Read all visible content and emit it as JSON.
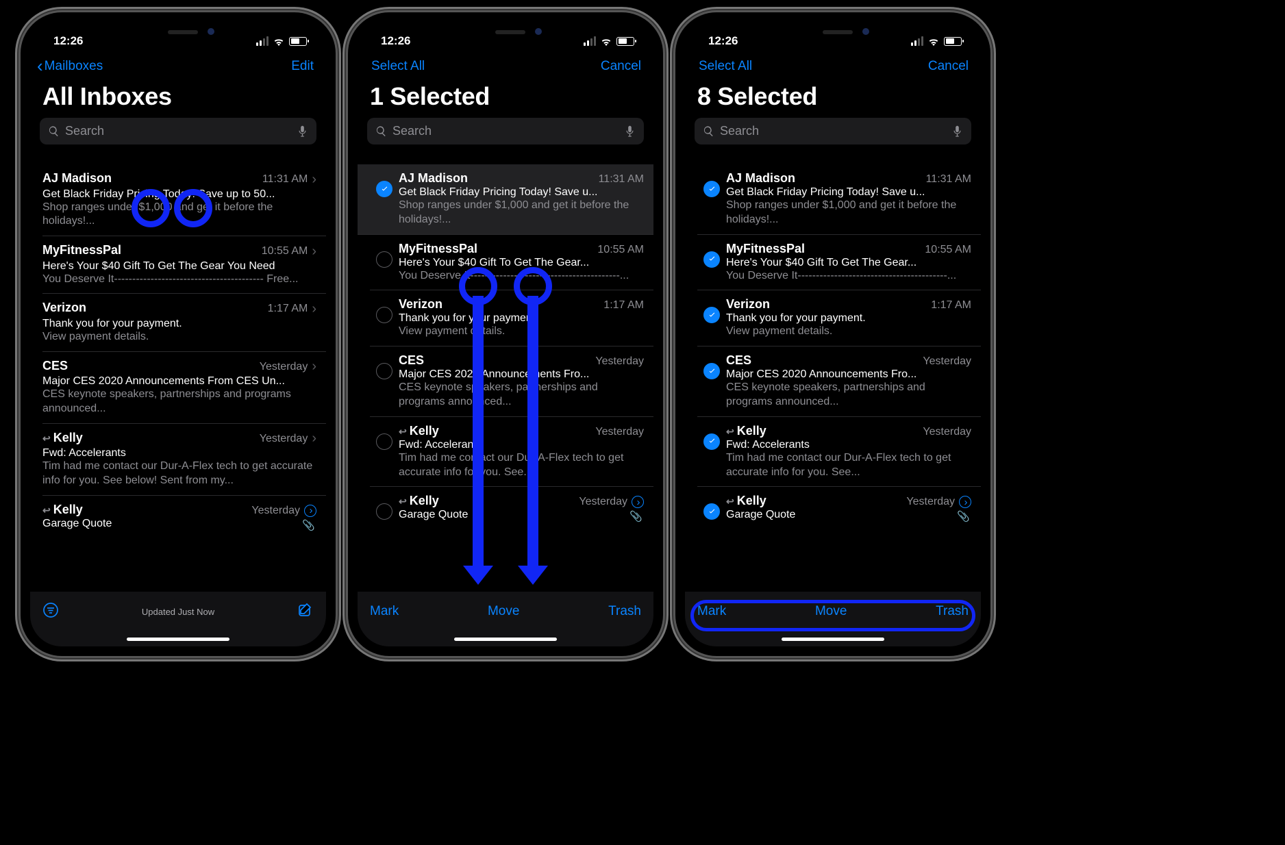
{
  "status": {
    "time": "12:26"
  },
  "search": {
    "placeholder": "Search"
  },
  "screens": [
    {
      "nav": {
        "left": "Mailboxes",
        "right": "Edit",
        "hasChevron": true
      },
      "title": "All Inboxes",
      "mode": "normal",
      "footer": {
        "type": "status",
        "center": "Updated Just Now"
      },
      "messages": [
        {
          "sender": "AJ Madison",
          "time": "11:31 AM",
          "subject": "Get Black Friday Pricing Today! Save up to 50...",
          "preview": "Shop ranges under $1,000 and get it before the holidays!...",
          "disclosure": true
        },
        {
          "sender": "MyFitnessPal",
          "time": "10:55 AM",
          "subject": "Here's Your $40 Gift To Get The Gear You Need",
          "preview": "You Deserve\nIt----------------------------------------- Free...",
          "disclosure": true
        },
        {
          "sender": "Verizon",
          "time": "1:17 AM",
          "subject": "Thank you for your payment.",
          "preview": "View payment details.",
          "disclosure": true
        },
        {
          "sender": "CES",
          "time": "Yesterday",
          "subject": "Major CES 2020 Announcements From CES Un...",
          "preview": "CES keynote speakers, partnerships and programs announced...",
          "disclosure": true
        },
        {
          "sender": "Kelly",
          "time": "Yesterday",
          "subject": "Fwd: Accelerants",
          "preview": "Tim had me contact our Dur-A-Flex tech to get accurate info for you. See below! Sent from my...",
          "disclosure": true,
          "reply": true
        },
        {
          "sender": "Kelly",
          "time": "Yesterday",
          "subject": "Garage Quote",
          "preview": "",
          "disclosure": true,
          "reply": true,
          "detail": true,
          "clip": true
        }
      ]
    },
    {
      "nav": {
        "left": "Select All",
        "right": "Cancel",
        "hasChevron": false
      },
      "title": "1 Selected",
      "mode": "edit",
      "footer": {
        "type": "actions",
        "left": "Mark",
        "center": "Move",
        "right": "Trash"
      },
      "messages": [
        {
          "sender": "AJ Madison",
          "time": "11:31 AM",
          "subject": "Get Black Friday Pricing Today! Save u...",
          "preview": "Shop ranges under $1,000 and get it before the holidays!...",
          "selected": true,
          "hl": true
        },
        {
          "sender": "MyFitnessPal",
          "time": "10:55 AM",
          "subject": "Here's Your $40 Gift To Get The Gear...",
          "preview": "You Deserve\nIt-----------------------------------------...",
          "selected": false
        },
        {
          "sender": "Verizon",
          "time": "1:17 AM",
          "subject": "Thank you for your payment.",
          "preview": "View payment details.",
          "selected": false
        },
        {
          "sender": "CES",
          "time": "Yesterday",
          "subject": "Major CES 2020 Announcements Fro...",
          "preview": "CES keynote speakers, partnerships and programs announced...",
          "selected": false
        },
        {
          "sender": "Kelly",
          "time": "Yesterday",
          "subject": "Fwd: Accelerants",
          "preview": "Tim had me contact our Dur-A-Flex tech to get accurate info for you. See...",
          "selected": false,
          "reply": true
        },
        {
          "sender": "Kelly",
          "time": "Yesterday",
          "subject": "Garage Quote",
          "preview": "",
          "selected": false,
          "reply": true,
          "detail": true,
          "clip": true
        }
      ]
    },
    {
      "nav": {
        "left": "Select All",
        "right": "Cancel",
        "hasChevron": false
      },
      "title": "8 Selected",
      "mode": "edit",
      "footer": {
        "type": "actions",
        "left": "Mark",
        "center": "Move",
        "right": "Trash"
      },
      "messages": [
        {
          "sender": "AJ Madison",
          "time": "11:31 AM",
          "subject": "Get Black Friday Pricing Today! Save u...",
          "preview": "Shop ranges under $1,000 and get it before the holidays!...",
          "selected": true
        },
        {
          "sender": "MyFitnessPal",
          "time": "10:55 AM",
          "subject": "Here's Your $40 Gift To Get The Gear...",
          "preview": "You Deserve\nIt-----------------------------------------...",
          "selected": true
        },
        {
          "sender": "Verizon",
          "time": "1:17 AM",
          "subject": "Thank you for your payment.",
          "preview": "View payment details.",
          "selected": true
        },
        {
          "sender": "CES",
          "time": "Yesterday",
          "subject": "Major CES 2020 Announcements Fro...",
          "preview": "CES keynote speakers, partnerships and programs announced...",
          "selected": true
        },
        {
          "sender": "Kelly",
          "time": "Yesterday",
          "subject": "Fwd: Accelerants",
          "preview": "Tim had me contact our Dur-A-Flex tech to get accurate info for you. See...",
          "selected": true,
          "reply": true
        },
        {
          "sender": "Kelly",
          "time": "Yesterday",
          "subject": "Garage Quote",
          "preview": "",
          "selected": true,
          "reply": true,
          "detail": true,
          "clip": true
        }
      ]
    }
  ]
}
